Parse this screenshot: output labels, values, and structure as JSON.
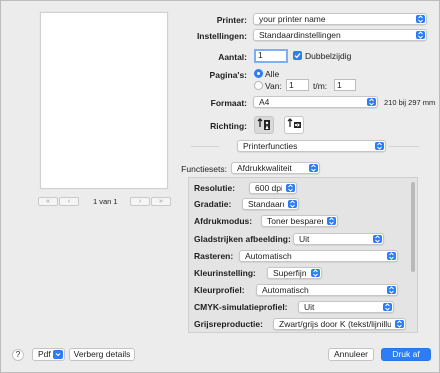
{
  "printer": {
    "label": "Printer:",
    "value": "your printer name"
  },
  "presets": {
    "label": "Instellingen:",
    "value": "Standaardinstellingen"
  },
  "copies": {
    "label": "Aantal:",
    "value": "1",
    "duplex_label": "Dubbelzijdig",
    "duplex_checked": true
  },
  "pages": {
    "label": "Pagina's:",
    "all_label": "Alle",
    "from_label": "Van:",
    "from_value": "1",
    "to_label": "t/m:",
    "to_value": "1",
    "selected": "all"
  },
  "paper": {
    "label": "Formaat:",
    "value": "A4",
    "size_text": "210 bij 297 mm"
  },
  "orientation": {
    "label": "Richting:",
    "selected": "portrait"
  },
  "preview": {
    "page_indicator": "1 van 1"
  },
  "section": {
    "value": "Printerfuncties"
  },
  "feature_sets": {
    "label": "Functiesets:",
    "value": "Afdrukkwaliteit"
  },
  "settings": [
    {
      "label": "Resolutie:",
      "value": "600 dpi"
    },
    {
      "label": "Gradatie:",
      "value": "Standaard"
    },
    {
      "label": "Afdrukmodus:",
      "value": "Toner besparen"
    },
    {
      "label": "Gladstrijken afbeelding:",
      "value": "Uit"
    },
    {
      "label": "Rasteren:",
      "value": "Automatisch"
    },
    {
      "label": "Kleurinstelling:",
      "value": "Superfijn"
    },
    {
      "label": "Kleurprofiel:",
      "value": "Automatisch"
    },
    {
      "label": "CMYK-simulatieprofiel:",
      "value": "Uit"
    },
    {
      "label": "Grijsreproductie:",
      "value": "Zwart/grijs door K (tekst/lijnillu..."
    }
  ],
  "footer": {
    "help": "?",
    "pdf": "Pdf",
    "hide_details": "Verberg details",
    "cancel": "Annuleer",
    "print": "Druk af"
  },
  "colors": {
    "accent": "#2d7df6",
    "panel": "#e4e4e4",
    "window": "#ececec"
  }
}
